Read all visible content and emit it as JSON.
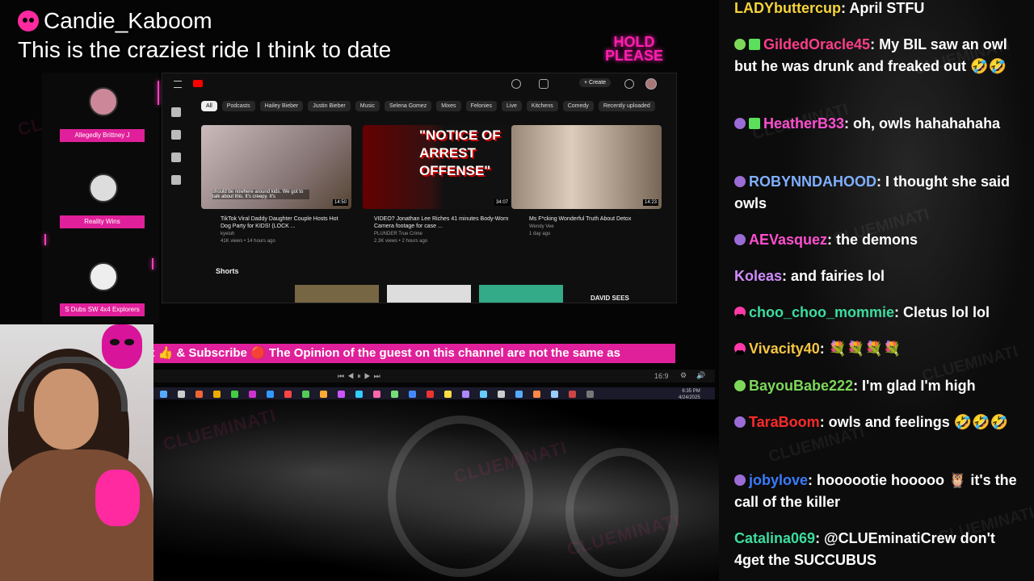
{
  "stream": {
    "alert_user": "Candie_Kaboom",
    "alert_message": "This is the craziest ride I think to date",
    "hold_badge": [
      "HOLD",
      "PLEASE"
    ],
    "watermark": "CLUEMINATI",
    "ticker_text": "at 👍 & Subscribe 🔴 The Opinion of the guest on this channel are not the same as",
    "guests": [
      "Allegedly Brittney J",
      "Reality Wins",
      "S Dubs SW 4x4 Explorers"
    ]
  },
  "youtube": {
    "chips": [
      "All",
      "Podcasts",
      "Hailey Bieber",
      "Justin Bieber",
      "Music",
      "Selena Gomez",
      "Mixes",
      "Felonies",
      "Live",
      "Kitchens",
      "Comedy",
      "Recently uploaded"
    ],
    "create_label": "+ Create",
    "shorts_label": "Shorts",
    "videos": [
      {
        "title": "TikTok Viral Daddy Daughter Couple Hosts Hot Dog Party for KIDS! (LOCK ...",
        "channel": "kyeluh",
        "meta": "41K views • 14 hours ago",
        "duration": "14:50",
        "caption": "should be nowhere around kids. We got to talk about this. It's creepy. It's"
      },
      {
        "title": "VIDEO? Jonathan Lee Riches 41 minutes Body-Worn Camera footage for case ...",
        "channel": "PLUNDER True Crime",
        "meta": "2.3K views • 2 hours ago",
        "duration": "34:07",
        "thumb_text": "\"NOTICE OF ARREST OFFENSE\""
      },
      {
        "title": "Ms F*cking Wonderful Truth About Detox",
        "channel": "Wendy Vee",
        "meta": "1 day ago",
        "duration": "14:23"
      }
    ],
    "shorts_caption": "DAVID SEES"
  },
  "player": {
    "ratio": "16:9"
  },
  "taskbar": {
    "time": "6:35 PM",
    "date": "4/24/2025"
  },
  "chat": [
    {
      "user": "LADYbuttercup",
      "color": "#f5d33a",
      "badge": "",
      "text": ": April STFU"
    },
    {
      "user": "GildedOracle45",
      "color": "#ff3d8a",
      "badge": "leaf-gift",
      "text": ": My BIL saw an owl but he was drunk and freaked out 🤣🤣"
    },
    {
      "user": "HeatherB33",
      "color": "#ff4fd0",
      "badge": "ghost-gift",
      "text": ": oh, owls hahahahaha"
    },
    {
      "user": "ROBYNNDAHOOD",
      "color": "#7fb0ff",
      "badge": "ghost",
      "text": ": I thought she said owls"
    },
    {
      "user": "AEVasquez",
      "color": "#ff4fd0",
      "badge": "ghost",
      "text": ": the demons"
    },
    {
      "user": "Koleas",
      "color": "#d08cff",
      "badge": "",
      "text": ": and fairies lol"
    },
    {
      "user": "choo_choo_mommie",
      "color": "#3ddca0",
      "badge": "skull",
      "text": ": Cletus lol lol"
    },
    {
      "user": "Vivacity40",
      "color": "#f5c542",
      "badge": "skull",
      "text": ": 💐💐💐💐"
    },
    {
      "user": "BayouBabe222",
      "color": "#7dd85a",
      "badge": "leaf",
      "text": ": I'm glad I'm high"
    },
    {
      "user": "TaraBoom",
      "color": "#ff2a2a",
      "badge": "ghost",
      "text": ": owls and feelings 🤣🤣🤣"
    },
    {
      "user": "jobylove",
      "color": "#3a7bff",
      "badge": "ghost",
      "text": ": hoooootie hooooo 🦉 it's the call of the killer"
    },
    {
      "user": "Catalina069",
      "color": "#3ddca0",
      "badge": "",
      "text": ": @CLUEminatiCrew don't 4get the SUCCUBUS"
    }
  ]
}
